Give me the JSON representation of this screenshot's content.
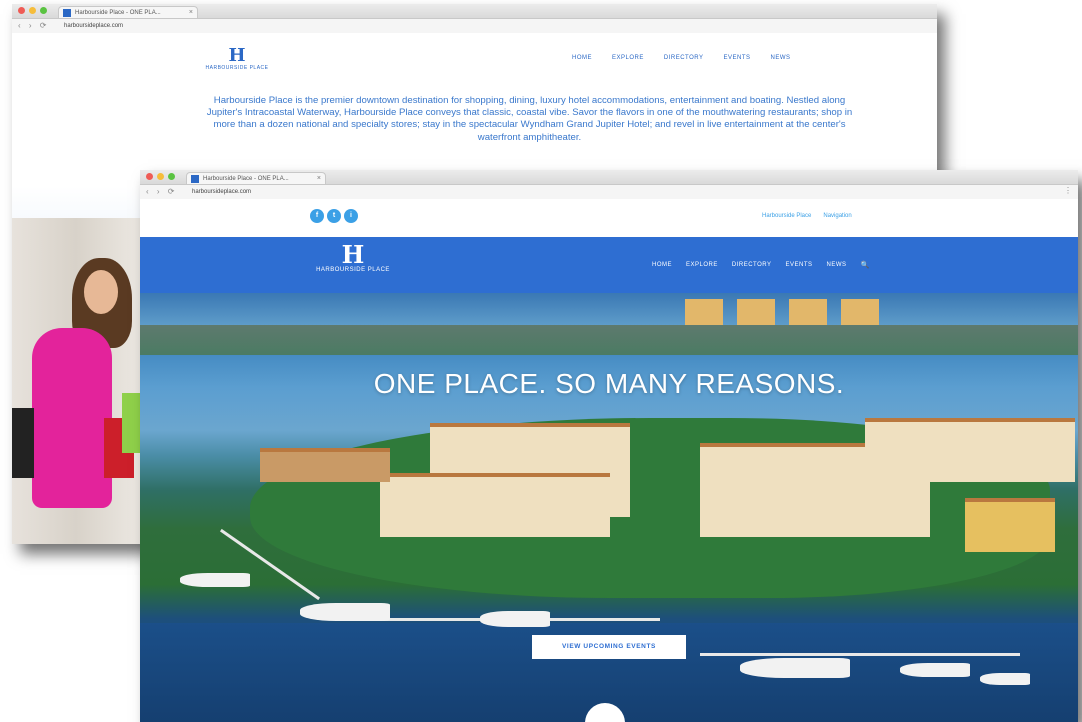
{
  "back_window": {
    "tab_title": "Harbourside Place - ONE PLA...",
    "url": "harboursideplace.com",
    "logo_text": "HARBOURSIDE PLACE",
    "nav": [
      "HOME",
      "EXPLORE",
      "DIRECTORY",
      "EVENTS",
      "NEWS"
    ],
    "intro": "Harbourside Place is the premier downtown destination for shopping, dining, luxury hotel accommodations, entertainment and boating. Nestled along Jupiter's Intracoastal Waterway, Harbourside Place conveys that classic, coastal vibe. Savor the flavors in one of the mouthwatering restaurants; shop in more than a dozen national and specialty stores; stay in the spectacular Wyndham Grand Jupiter Hotel; and revel in live entertainment at the center's waterfront amphitheater."
  },
  "front_window": {
    "tab_title": "Harbourside Place - ONE PLA...",
    "url": "harboursideplace.com",
    "social": [
      "f",
      "t",
      "i"
    ],
    "top_links": [
      "Harbourside Place",
      "Navigation"
    ],
    "logo_text": "HARBOURSIDE PLACE",
    "nav": [
      "HOME",
      "EXPLORE",
      "DIRECTORY",
      "EVENTS",
      "NEWS"
    ],
    "search_icon": "🔍",
    "headline": "ONE PLACE. SO MANY REASONS.",
    "cta_label": "VIEW UPCOMING EVENTS"
  },
  "colors": {
    "brand_blue": "#2e6ed2",
    "social_blue": "#3ba0e6",
    "intro_text": "#3a78cc"
  }
}
